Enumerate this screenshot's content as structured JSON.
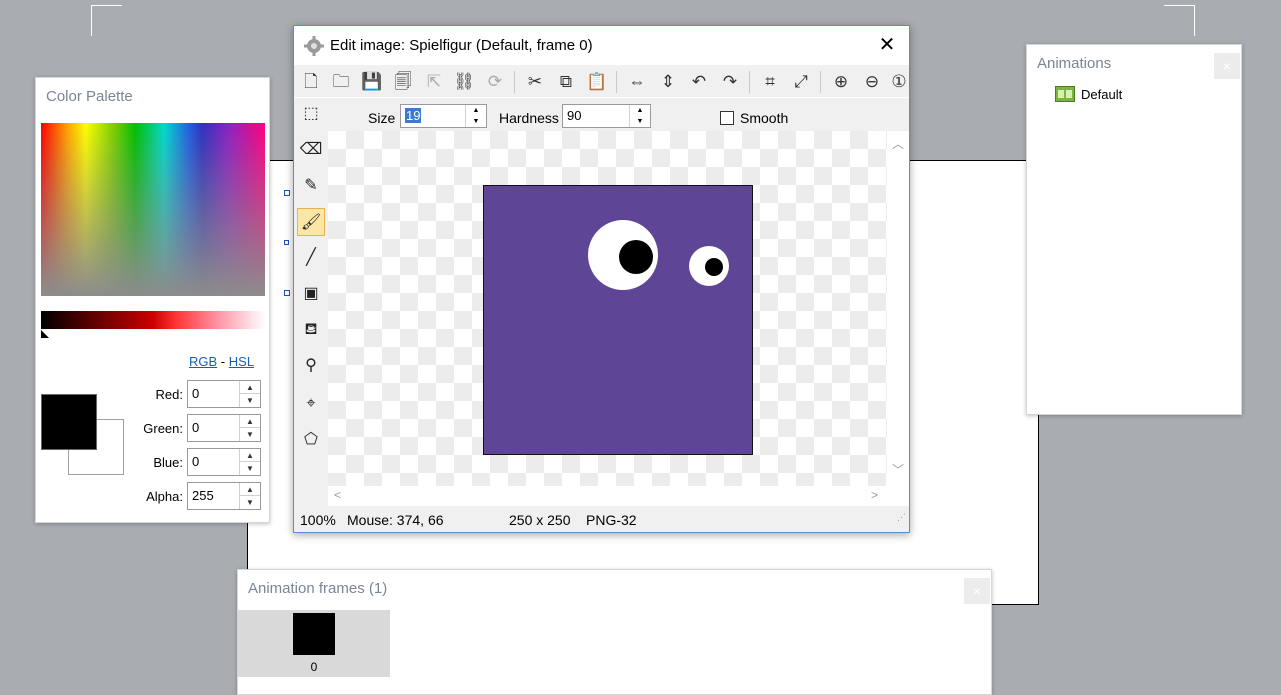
{
  "colors": {
    "sprite_fill": "#5f4596",
    "accent_blue": "#1a5fb4",
    "active_tool": "#fce6a6"
  },
  "color_palette": {
    "title": "Color Palette",
    "rgb_link": "RGB",
    "separator": "-",
    "hsl_link": "HSL",
    "red_label": "Red:",
    "red_value": "0",
    "green_label": "Green:",
    "green_value": "0",
    "blue_label": "Blue:",
    "blue_value": "0",
    "alpha_label": "Alpha:",
    "alpha_value": "255"
  },
  "animations": {
    "title": "Animations",
    "close_icon": "×",
    "items": [
      {
        "label": "Default",
        "icon": "film-strip-icon"
      }
    ]
  },
  "frames": {
    "title": "Animation frames (1)",
    "close_icon": "×",
    "items": [
      {
        "index": "0"
      }
    ]
  },
  "editor": {
    "title": "Edit image: Spielfigur (Default, frame 0)",
    "close_icon": "✕",
    "options": {
      "size_label": "Size",
      "size_value": "19",
      "hardness_label": "Hardness",
      "hardness_value": "90",
      "smooth_label": "Smooth"
    },
    "status": {
      "zoom": "100%",
      "mouse": "Mouse: 374, 66",
      "dimensions": "250 x 250",
      "format": "PNG-32"
    },
    "toolbar_icons": [
      "new-file-icon",
      "open-folder-icon",
      "save-icon",
      "save-copy-icon",
      "export-icon",
      "link-icon",
      "refresh-icon",
      "cut-icon",
      "copy-icon",
      "paste-icon",
      "flip-horizontal-icon",
      "flip-vertical-icon",
      "rotate-left-icon",
      "rotate-right-icon",
      "crop-icon",
      "resize-icon",
      "zoom-in-icon",
      "zoom-out-icon",
      "zoom-reset-icon"
    ],
    "tool_icons": [
      "selection-icon",
      "eraser-icon",
      "pencil-icon",
      "brush-icon",
      "line-icon",
      "rectangle-icon",
      "fill-bucket-icon",
      "eyedropper-icon",
      "origin-icon",
      "polygon-icon"
    ],
    "active_tool": "brush-icon"
  }
}
